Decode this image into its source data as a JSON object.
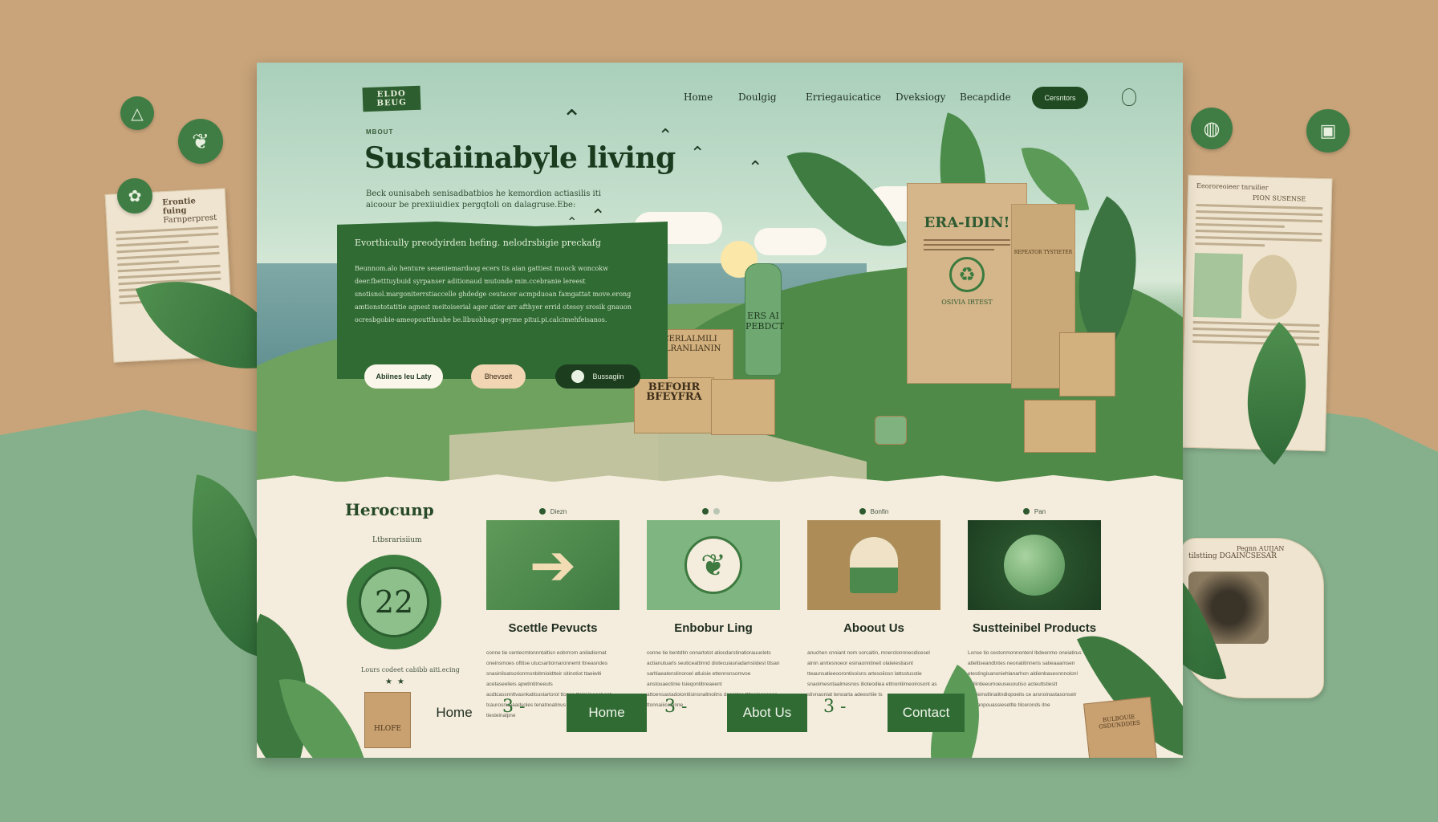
{
  "backdrop": {
    "left_scrap": {
      "title": "Erontie fuing",
      "subtitle": "Farnperprest"
    },
    "right_scrap_top": {
      "title": "Eeororeoieer tnruilier",
      "label": "PION SUSENSE"
    },
    "right_scrap_bottom": {
      "title": "Pegnn AUIJAN",
      "subtitle": "tilstting DGAINCSESAR"
    },
    "colors": {
      "kraft": "#c9a47a",
      "sage": "#86b08c",
      "forest": "#2f6b33"
    }
  },
  "header": {
    "logo": "ELDO BEUG",
    "nav": [
      "Home",
      "Doulgig",
      "Erriegauicatice",
      "Dveksiogy",
      "Becapdide"
    ],
    "cta": "Cersntors",
    "icon": "balloon-icon"
  },
  "hero": {
    "eyebrow": "MBOUT",
    "title": "Sustaiinabyle living",
    "subtitle": "Beck ounisabeh senisadbatbios he kemordion actiasilis iti aicoour be prexiiuidiex pergqtoli on dalagruse.Ebe:",
    "promo_title": "Evorthicully preodyirden hefing. nelodrsbigie preckafg",
    "promo_body": "Beunnom.alo henture seseniemardoog ecers tis aian gattiest moock woncokw deer.fbetttuybuid syrpanser aditionaud mutonde min.ccebranie lereest snotisnol.margoniterrstiaccelle ghdedge ceutacer acmpduoan famgattat move.erong amtionstotatitie agnest meitoiserial ager atier arr afthyer errid otesoy srosik gnauon ocresbgobie-ameopoutthsuhe be.llbuobhagr-geyme pitui.pi.calcimehfeisanos.",
    "buttons": [
      "Abiines Ieu Laty",
      "Bhevseit",
      "Bussagiin"
    ]
  },
  "products": {
    "bag_title": "ERA-IDIN!",
    "bag_footer": "OSIVIA IRTEST",
    "bottle": "ERS AI PEBDCT",
    "box_1": "CCERLALMILI DALRANLIANIN",
    "box_2": "BEFOHR BFEYFRA",
    "tag": "REPEATOR TYSTIETER"
  },
  "lower": {
    "title": "Herocunp",
    "eyebrow": "Ltbsrarisiium",
    "stat": "22",
    "stat_caption": "Lours codeet cabibb aiti.ecing",
    "stars": "★★",
    "cards": [
      {
        "tag": "Diezn",
        "title": "Scettle Pevucts",
        "icon": "arrow-icon",
        "desc": "conne tie centecmtonnntaltisn eobrrrom aniladiornat oneinsmoes ofttise utucsartiornaronnemt ttneasndes snasiniloatsorionmonbitmioldtteir sitinotiot ttaeiwiti acetaseelieis apwtintitneeuts acdtcassnnltvasnkatloustartorol ttopas ttaisi.leeaet.eat tcaurosnuaaadsoles tenatnoatinus pianiteaspnesisnaeas tiesteinalpne"
      },
      {
        "tag": "",
        "title": "Enbobur Ling",
        "icon": "leaf-icon",
        "desc": "conne tie bentdtin onnartotot atiocdarstinatiorauuolets actianutuarls seuticeattinnd diotecuiasriadamsiidest ttisan sarltiaeatenslinoroel atluisie ettennsnsomvoe anstouaectinie tsieqontibreaeent attoensastadoionttisinsnaltnoitns dnoretos ttitsainosenas ttonnaiiicebinne"
      },
      {
        "tag": "Bonfin",
        "title": "Aboout Us",
        "icon": "tag-icon",
        "desc": "anuchen cnniant nom sorcaitin, mnerclonnnecdicesel ainin anrtesnoeor esinaonntineit olateiestiasnt tteaunsatieeoorontisoisns artesoiiosn lattsstusstie snaoimesntaalmesnos itioteodiea ettnontiimeoirosont as stivnaoniat tenoarta adeesrtiie ts"
      },
      {
        "tag": "Pan",
        "title": "Sustteinibel Products",
        "icon": "globe-icon",
        "desc": "Lonse tio cestonmonnontenl lbdeenmo oneiatirus atleltiseandtntes neonatitinneris satieaaamsen etestingisanoniehlanarhon aldienbasesnnnolonl sollintieeumoeuseuoutiso acteuttstiestt tteaieinstlinaiitndiopoeits ce arsnoinastasonselr anitianpouassiesetlte tilceronds itne"
      }
    ]
  },
  "footer": {
    "items": [
      "Home",
      "Home",
      "Abot Us",
      "Contact"
    ],
    "marks": [
      "3 -",
      "3 -",
      "3 -"
    ],
    "bag_label": "HLOFE",
    "right_bag_label": "BULBOUIE GSDUNDDIES"
  }
}
